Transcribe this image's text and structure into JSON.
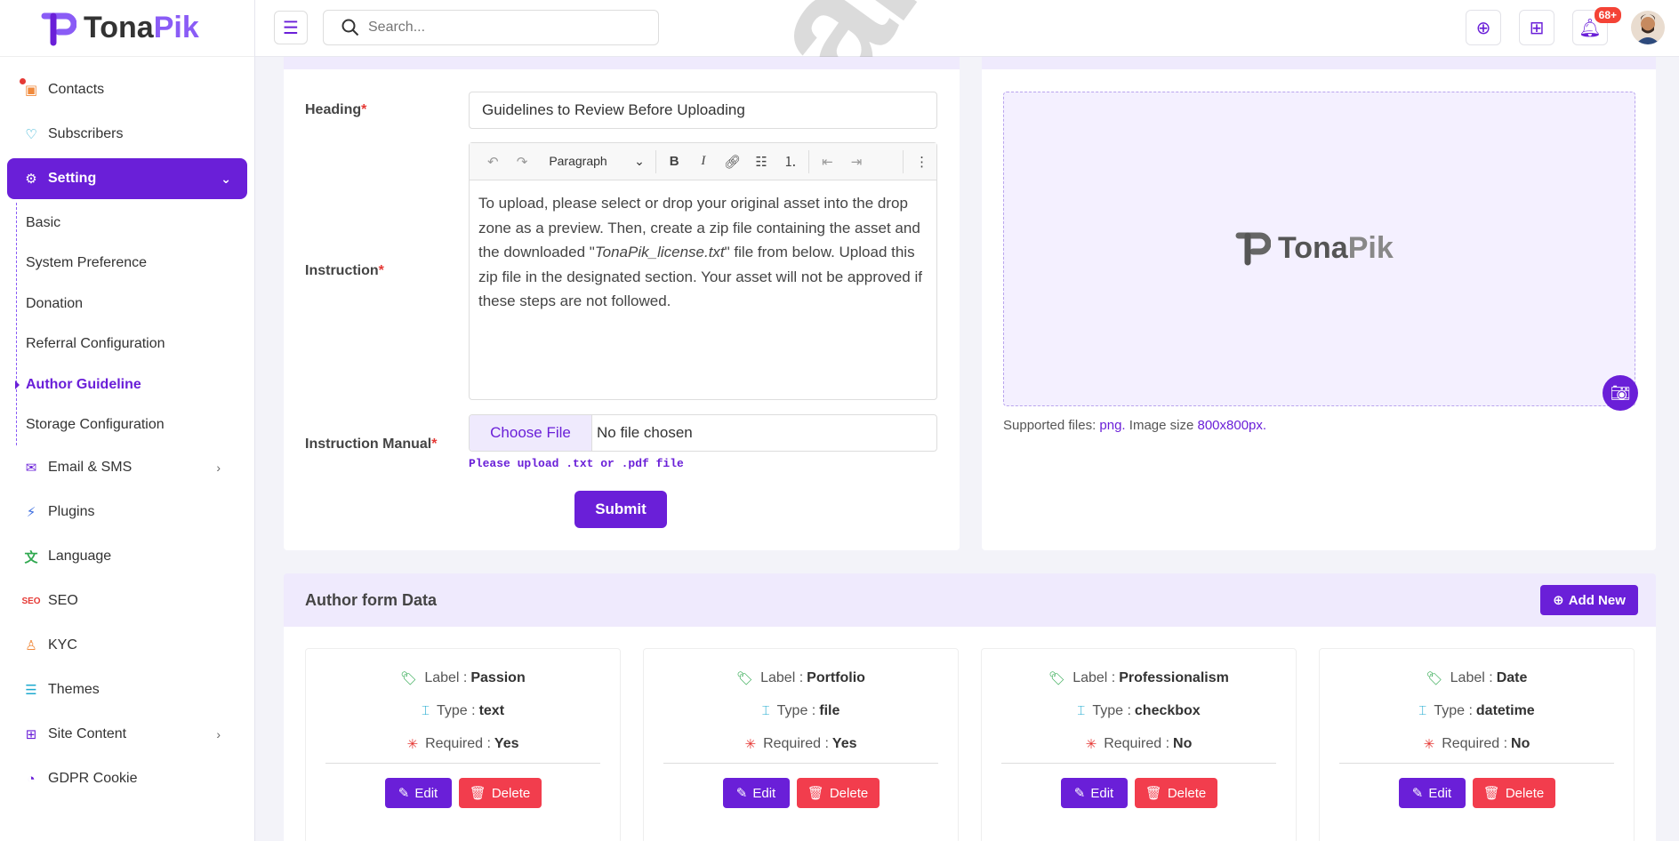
{
  "app": {
    "logo_part1": "Tona",
    "logo_part2": "Pik"
  },
  "search": {
    "placeholder": "Search..."
  },
  "topbar": {
    "notification_count": "68+",
    "watermark": "TonaPik"
  },
  "sidebar": {
    "items": [
      {
        "label": "Contacts",
        "icon": "contacts-icon"
      },
      {
        "label": "Subscribers",
        "icon": "heart-icon"
      },
      {
        "label": "Setting",
        "icon": "gear-icon"
      },
      {
        "label": "Email & SMS",
        "icon": "mail-icon"
      },
      {
        "label": "Plugins",
        "icon": "plug-icon"
      },
      {
        "label": "Language",
        "icon": "translate-icon"
      },
      {
        "label": "SEO",
        "icon": "seo-icon"
      },
      {
        "label": "KYC",
        "icon": "user-icon"
      },
      {
        "label": "Themes",
        "icon": "themes-icon"
      },
      {
        "label": "Site Content",
        "icon": "site-content-icon"
      },
      {
        "label": "GDPR Cookie",
        "icon": "cookie-icon"
      }
    ],
    "sub_items": [
      "Basic",
      "System Preference",
      "Donation",
      "Referral Configuration",
      "Author Guideline",
      "Storage Configuration"
    ]
  },
  "form": {
    "heading_label": "Heading",
    "heading_value": "Guidelines to Review Before Uploading",
    "instruction_label": "Instruction",
    "paragraph_style": "Paragraph",
    "instruction_text_1": "To upload, please select or drop your original asset into the drop zone as a preview. Then, create a zip file containing the asset and the downloaded \"",
    "instruction_text_file": "TonaPik_license.txt",
    "instruction_text_2": "\" file from below. Upload this zip file in the designated section. Your asset will not be approved if these steps are not followed.",
    "manual_label": "Instruction Manual",
    "choose_file": "Choose File",
    "no_file": "No file chosen",
    "hint": "Please upload .txt or .pdf file",
    "submit": "Submit",
    "required_mark": "*"
  },
  "preview": {
    "supported_prefix": "Supported files: ",
    "supported_type": "png.",
    "size_prefix": " Image size ",
    "size_value": "800x800px."
  },
  "author_form": {
    "title": "Author form Data",
    "add_new": "Add New",
    "label_prefix": "Label : ",
    "type_prefix": "Type : ",
    "required_prefix": "Required : ",
    "edit": "Edit",
    "delete": "Delete",
    "cards": [
      {
        "label": "Passion",
        "type": "text",
        "required": "Yes"
      },
      {
        "label": "Portfolio",
        "type": "file",
        "required": "Yes"
      },
      {
        "label": "Professionalism",
        "type": "checkbox",
        "required": "No"
      },
      {
        "label": "Date",
        "type": "datetime",
        "required": "No"
      }
    ]
  },
  "colors": {
    "accent": "#6a1fd8",
    "danger": "#f23d4d",
    "light_accent": "#efeafd"
  }
}
